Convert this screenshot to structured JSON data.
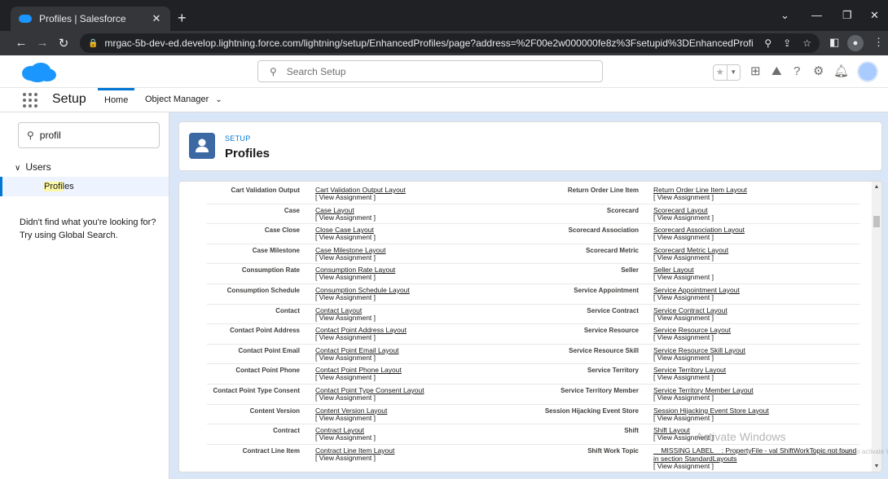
{
  "browser": {
    "tab_title": "Profiles | Salesforce",
    "tab_close": "✕",
    "new_tab": "+",
    "url": "mrgac-5b-dev-ed.develop.lightning.force.com/lightning/setup/EnhancedProfiles/page?address=%2F00e2w000000fe8z%3Fsetupid%3DEnhancedProfiles%26appLa..."
  },
  "header": {
    "search_placeholder": "Search Setup"
  },
  "nav": {
    "app_name": "Setup",
    "tabs": [
      {
        "label": "Home"
      },
      {
        "label": "Object Manager"
      }
    ]
  },
  "sidebar": {
    "quick_find_value": "profil",
    "group_label": "Users",
    "item_label_highlight": "Profi",
    "item_label_rest": "les",
    "not_found_line1": "Didn't find what you're looking for?",
    "not_found_line2": "Try using Global Search."
  },
  "page_header": {
    "eyebrow": "SETUP",
    "title": "Profiles"
  },
  "view_assignment": "[ View Assignment ]",
  "layouts_left": [
    {
      "object": "Cart Validation Output",
      "layout": "Cart Validation Output Layout"
    },
    {
      "object": "Case",
      "layout": "Case Layout"
    },
    {
      "object": "Case Close",
      "layout": "Close Case Layout"
    },
    {
      "object": "Case Milestone",
      "layout": "Case Milestone Layout"
    },
    {
      "object": "Consumption Rate",
      "layout": "Consumption Rate Layout"
    },
    {
      "object": "Consumption Schedule",
      "layout": "Consumption Schedule Layout"
    },
    {
      "object": "Contact",
      "layout": "Contact Layout"
    },
    {
      "object": "Contact Point Address",
      "layout": "Contact Point Address Layout"
    },
    {
      "object": "Contact Point Email",
      "layout": "Contact Point Email Layout"
    },
    {
      "object": "Contact Point Phone",
      "layout": "Contact Point Phone Layout"
    },
    {
      "object": "Contact Point Type Consent",
      "layout": "Contact Point Type Consent Layout"
    },
    {
      "object": "Content Version",
      "layout": "Content Version Layout"
    },
    {
      "object": "Contract",
      "layout": "Contract Layout"
    },
    {
      "object": "Contract Line Item",
      "layout": "Contract Line Item Layout"
    }
  ],
  "layouts_right": [
    {
      "object": "Return Order Line Item",
      "layout": "Return Order Line Item Layout"
    },
    {
      "object": "Scorecard",
      "layout": "Scorecard Layout"
    },
    {
      "object": "Scorecard Association",
      "layout": "Scorecard Association Layout"
    },
    {
      "object": "Scorecard Metric",
      "layout": "Scorecard Metric Layout"
    },
    {
      "object": "Seller",
      "layout": "Seller Layout"
    },
    {
      "object": "Service Appointment",
      "layout": "Service Appointment Layout"
    },
    {
      "object": "Service Contract",
      "layout": "Service Contract Layout"
    },
    {
      "object": "Service Resource",
      "layout": "Service Resource Layout"
    },
    {
      "object": "Service Resource Skill",
      "layout": "Service Resource Skill Layout"
    },
    {
      "object": "Service Territory",
      "layout": "Service Territory Layout"
    },
    {
      "object": "Service Territory Member",
      "layout": "Service Territory Member Layout"
    },
    {
      "object": "Session Hijacking Event Store",
      "layout": "Session Hijacking Event Store Layout"
    },
    {
      "object": "Shift",
      "layout": "Shift Layout"
    },
    {
      "object": "Shift Work Topic",
      "layout": "__MISSING LABEL__: PropertyFile - val ShiftWorkTopic not found in section StandardLayouts"
    }
  ],
  "watermark": {
    "line1": "Activate Windows",
    "line2": "Go to Settings to activate Windows."
  },
  "colors": {
    "brand": "#0176d3",
    "page_bg": "#d8e6f7"
  }
}
